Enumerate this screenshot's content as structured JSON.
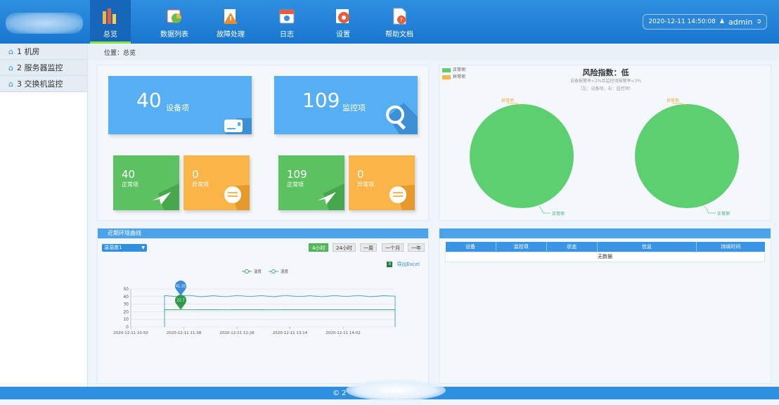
{
  "top": {
    "nav": [
      {
        "label": "总览",
        "icon": "chart-icon"
      },
      {
        "label": "数据列表",
        "icon": "data-list-icon"
      },
      {
        "label": "故障处理",
        "icon": "warning-icon"
      },
      {
        "label": "日志",
        "icon": "calendar-icon"
      },
      {
        "label": "设置",
        "icon": "gear-icon"
      },
      {
        "label": "帮助文档",
        "icon": "help-doc-icon"
      }
    ],
    "datetime": "2020-12-11 14:50:08",
    "user": "admin"
  },
  "sidebar": {
    "items": [
      {
        "label": "1 机房"
      },
      {
        "label": "2 服务器监控"
      },
      {
        "label": "3 交换机监控"
      }
    ]
  },
  "breadcrumb": "位置：总览",
  "tiles": {
    "devices": {
      "value": "40",
      "label": "设备项"
    },
    "monitors": {
      "value": "109",
      "label": "监控项"
    },
    "dev_normal": {
      "value": "40",
      "label": "正常项"
    },
    "dev_abnormal": {
      "value": "0",
      "label": "异常项"
    },
    "mon_normal": {
      "value": "109",
      "label": "正常项"
    },
    "mon_abnormal": {
      "value": "0",
      "label": "异常项"
    }
  },
  "risk": {
    "title": "风险指数：低",
    "subtitle": "设备报警率<1%且监控项报警率<3%",
    "note": "（左：设备项，右：监控项）",
    "legend": [
      {
        "label": "正常项",
        "color": "#5ccf70"
      },
      {
        "label": "异常项",
        "color": "#fbb447"
      }
    ],
    "pie_labels": {
      "abnormal": "异常项",
      "normal": "正常项"
    }
  },
  "curve": {
    "title": "近期环境曲线",
    "select": "温湿度1",
    "ranges": [
      "4小时",
      "24小时",
      "一周",
      "一个月",
      "一年"
    ],
    "active_range": "4小时",
    "export": "导出Excel",
    "legend": [
      "温度",
      "湿度"
    ],
    "markers": {
      "top": "41.35",
      "bottom": "22.7"
    }
  },
  "table": {
    "headers": [
      "设备",
      "监控项",
      "状态",
      "信息",
      "持续时间"
    ],
    "empty": "无数据"
  },
  "footer": "© 2",
  "chart_data": [
    {
      "type": "pie",
      "categories": [
        "正常项",
        "异常项"
      ],
      "values": [
        40,
        0
      ],
      "colors": [
        "#5ccf70",
        "#fbb447"
      ]
    },
    {
      "type": "pie",
      "categories": [
        "正常项",
        "异常项"
      ],
      "values": [
        109,
        0
      ],
      "colors": [
        "#5ccf70",
        "#fbb447"
      ]
    },
    {
      "type": "line",
      "x_ticks": [
        "2020-12-11 10:50",
        "2020-12-11 11:38",
        "2020-12-11 12:26",
        "2020-12-11 13:14",
        "2020-12-11 14:02"
      ],
      "y_ticks": [
        0,
        10,
        20,
        30,
        40,
        50
      ],
      "ylim": [
        0,
        50
      ],
      "series": [
        {
          "name": "温度",
          "color": "#3aa86a",
          "values": [
            22.7,
            22.7,
            22.6,
            22.7,
            22.7,
            22.8,
            22.7,
            22.7,
            22.7,
            22.6,
            22.7,
            22.7,
            22.7,
            22.7,
            22.7,
            22.7,
            22.7,
            22.7,
            22.7,
            22.7
          ]
        },
        {
          "name": "湿度",
          "color": "#4a9fd8",
          "values": [
            41.35,
            40,
            41.8,
            39.8,
            41.2,
            39.9,
            41.5,
            40.1,
            41.3,
            39.8,
            41.6,
            40.0,
            41.1,
            39.9,
            41.4,
            40.2,
            41.5,
            39.8,
            41.2,
            40.6
          ]
        }
      ]
    }
  ]
}
